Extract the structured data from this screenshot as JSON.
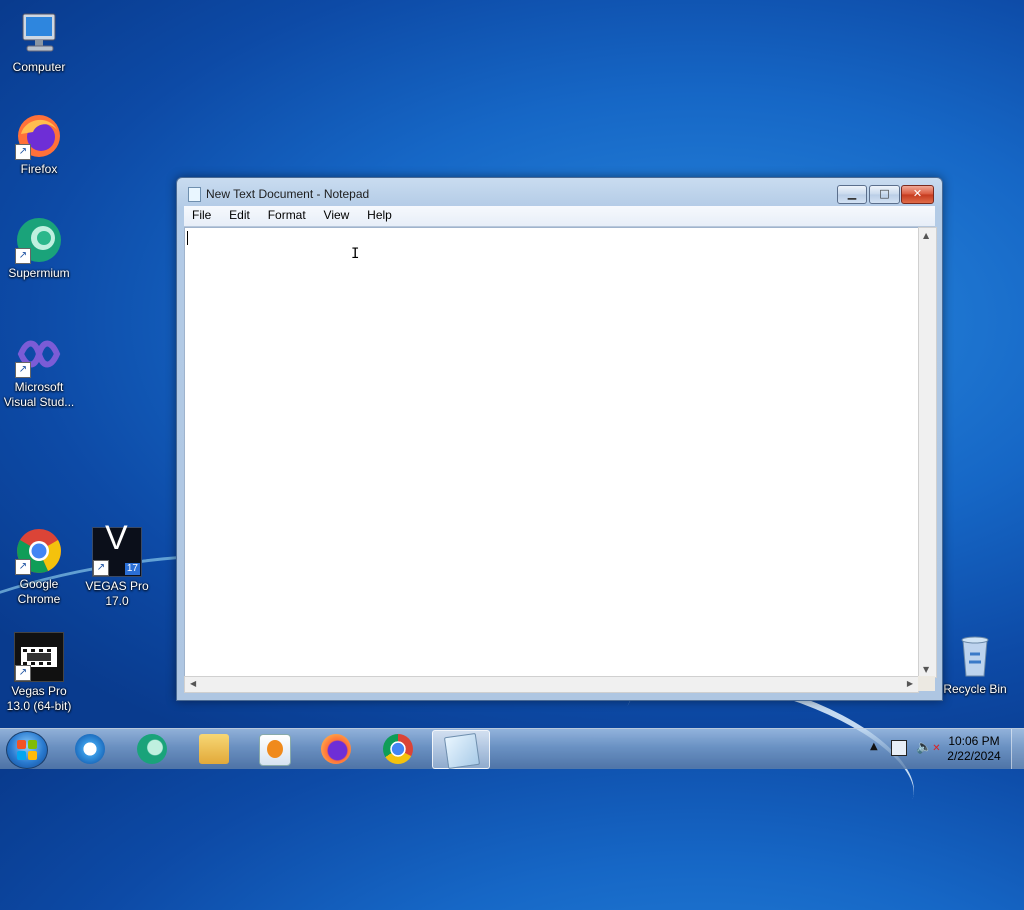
{
  "desktop": {
    "icons": [
      {
        "label": "Computer"
      },
      {
        "label": "Firefox"
      },
      {
        "label": "Supermium"
      },
      {
        "label": "Microsoft Visual Stud..."
      },
      {
        "label": "Google Chrome"
      },
      {
        "label": "VEGAS Pro 17.0",
        "badge": "17",
        "glyph": "V"
      },
      {
        "label": "Vegas Pro 13.0 (64-bit)"
      },
      {
        "label": "Recycle Bin"
      }
    ]
  },
  "notepad": {
    "title": "New Text Document - Notepad",
    "menu": [
      "File",
      "Edit",
      "Format",
      "View",
      "Help"
    ],
    "content": ""
  },
  "taskbar": {
    "clock_time": "10:06 PM",
    "clock_date": "2/22/2024"
  },
  "colors": {
    "desktop_blue": "#1667c6",
    "close_red": "#c43a1f",
    "window_frame": "#b3cbe6"
  }
}
